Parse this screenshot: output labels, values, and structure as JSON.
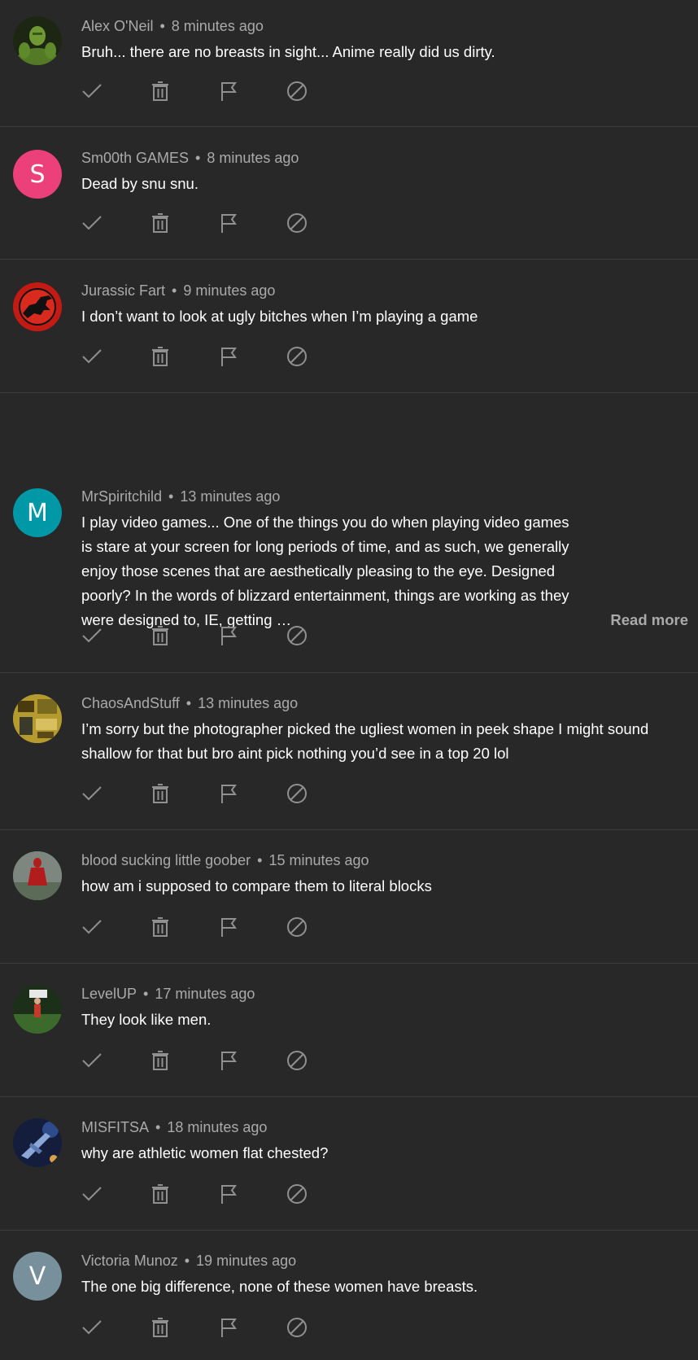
{
  "comments": [
    {
      "author": "Alex O'Neil",
      "time": "8 minutes ago",
      "text": "Bruh... there are no breasts in sight... Anime really did us dirty.",
      "avatar": {
        "type": "image",
        "icon": "hulk-avatar-icon",
        "bg": "#2e3a1c",
        "fg": "#6f9a33"
      }
    },
    {
      "author": "Sm00th GAMES",
      "time": "8 minutes ago",
      "text": "Dead by snu snu.",
      "avatar": {
        "type": "letter",
        "letter": "S",
        "bg": "#ec407a"
      }
    },
    {
      "author": "Jurassic Fart",
      "time": "9 minutes ago",
      "text": "I don’t want to look at ugly bitches when I’m playing a game",
      "avatar": {
        "type": "image",
        "icon": "jurassic-park-logo-icon",
        "bg": "#c41a14",
        "fg": "#111111"
      }
    },
    {
      "author": "MrSpiritchild",
      "time": "13 minutes ago",
      "text": "I play video games... One of the things you do when playing video games is stare at your screen for long periods of time, and as such, we generally enjoy those scenes that are aesthetically pleasing to the eye. Designed poorly? In the words of blizzard entertainment, things are working as they were designed to, IE, getting …",
      "read_more": "Read more",
      "avatar": {
        "type": "letter",
        "letter": "M",
        "bg": "#0097a7"
      }
    },
    {
      "author": "ChaosAndStuff",
      "time": "13 minutes ago",
      "text": "I’m sorry but the photographer picked the ugliest women in peek shape I might sound shallow for that but bro aint pick nothing you’d see in a top 20 lol",
      "avatar": {
        "type": "image",
        "icon": "collage-avatar-icon",
        "bg": "#b59a2e",
        "fg": "#4a3a10"
      }
    },
    {
      "author": "blood sucking little goober",
      "time": "15 minutes ago",
      "text": "how am i supposed to compare them to literal blocks",
      "avatar": {
        "type": "image",
        "icon": "red-figure-avatar-icon",
        "bg": "#6f7a74",
        "fg": "#b11d1d"
      }
    },
    {
      "author": "LevelUP",
      "time": "17 minutes ago",
      "text": "They look like men.",
      "avatar": {
        "type": "image",
        "icon": "field-photo-avatar-icon",
        "bg": "#1f3b1d",
        "fg": "#c23a2a"
      }
    },
    {
      "author": "MISFITSA",
      "time": "18 minutes ago",
      "text": "why are athletic women flat chested?",
      "avatar": {
        "type": "image",
        "icon": "jet-avatar-icon",
        "bg": "#1b2a55",
        "fg": "#8aa7d6"
      }
    },
    {
      "author": "Victoria Munoz",
      "time": "19 minutes ago",
      "text": "The one big difference, none of these women have breasts.",
      "avatar": {
        "type": "letter",
        "letter": "V",
        "bg": "#78909c"
      }
    }
  ],
  "actions": [
    {
      "name": "approve-icon"
    },
    {
      "name": "delete-icon"
    },
    {
      "name": "flag-icon"
    },
    {
      "name": "block-icon"
    }
  ],
  "colors": {
    "background": "#282828",
    "divider": "#3d3d3d",
    "meta": "#aaaaaa",
    "text": "#ffffff",
    "icon": "#909090"
  }
}
